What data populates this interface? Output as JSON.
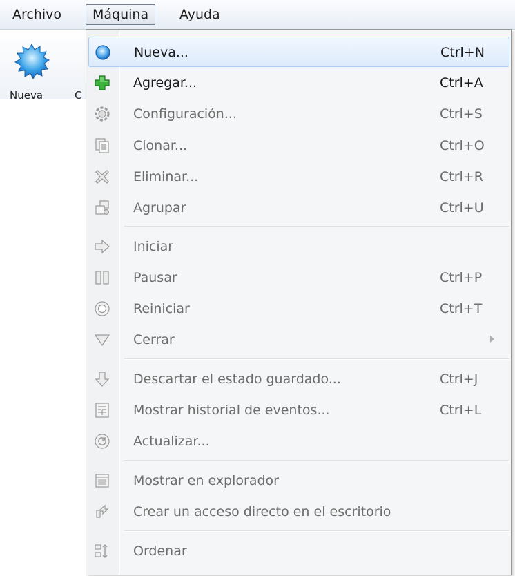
{
  "menubar": {
    "items": [
      {
        "label": "Archivo"
      },
      {
        "label": "Máquina",
        "active": true
      },
      {
        "label": "Ayuda"
      }
    ]
  },
  "toolbar": {
    "new_label": "Nueva",
    "next_label_fragment": "C"
  },
  "menu": {
    "items": [
      {
        "label": "Nueva...",
        "shortcut": "Ctrl+N",
        "icon": "new-vm-icon",
        "enabled": true,
        "highlighted": true
      },
      {
        "label": "Agregar...",
        "shortcut": "Ctrl+A",
        "icon": "add-icon",
        "enabled": true
      },
      {
        "label": "Configuración...",
        "shortcut": "Ctrl+S",
        "icon": "settings-icon",
        "enabled": false
      },
      {
        "label": "Clonar...",
        "shortcut": "Ctrl+O",
        "icon": "clone-icon",
        "enabled": false
      },
      {
        "label": "Eliminar...",
        "shortcut": "Ctrl+R",
        "icon": "remove-icon",
        "enabled": false
      },
      {
        "label": "Agrupar",
        "shortcut": "Ctrl+U",
        "icon": "group-icon",
        "enabled": false
      },
      {
        "label": "Iniciar",
        "shortcut": "",
        "icon": "start-icon",
        "enabled": false
      },
      {
        "label": "Pausar",
        "shortcut": "Ctrl+P",
        "icon": "pause-icon",
        "enabled": false
      },
      {
        "label": "Reiniciar",
        "shortcut": "Ctrl+T",
        "icon": "reset-icon",
        "enabled": false
      },
      {
        "label": "Cerrar",
        "shortcut": "",
        "icon": "close-icon",
        "enabled": false,
        "submenu": true
      },
      {
        "label": "Descartar el estado guardado...",
        "shortcut": "Ctrl+J",
        "icon": "discard-icon",
        "enabled": false
      },
      {
        "label": "Mostrar historial de eventos...",
        "shortcut": "Ctrl+L",
        "icon": "log-icon",
        "enabled": false
      },
      {
        "label": "Actualizar...",
        "shortcut": "",
        "icon": "refresh-icon",
        "enabled": false
      },
      {
        "label": "Mostrar en explorador",
        "shortcut": "",
        "icon": "explorer-icon",
        "enabled": false
      },
      {
        "label": "Crear un acceso directo en el escritorio",
        "shortcut": "",
        "icon": "shortcut-icon",
        "enabled": false
      },
      {
        "label": "Ordenar",
        "shortcut": "",
        "icon": "sort-icon",
        "enabled": false
      }
    ]
  },
  "colors": {
    "highlight_border": "#a9cdf3",
    "enabled_text": "#1a1a1a",
    "disabled_text": "#6d6d6d",
    "menu_background": "#f5f6f7"
  }
}
